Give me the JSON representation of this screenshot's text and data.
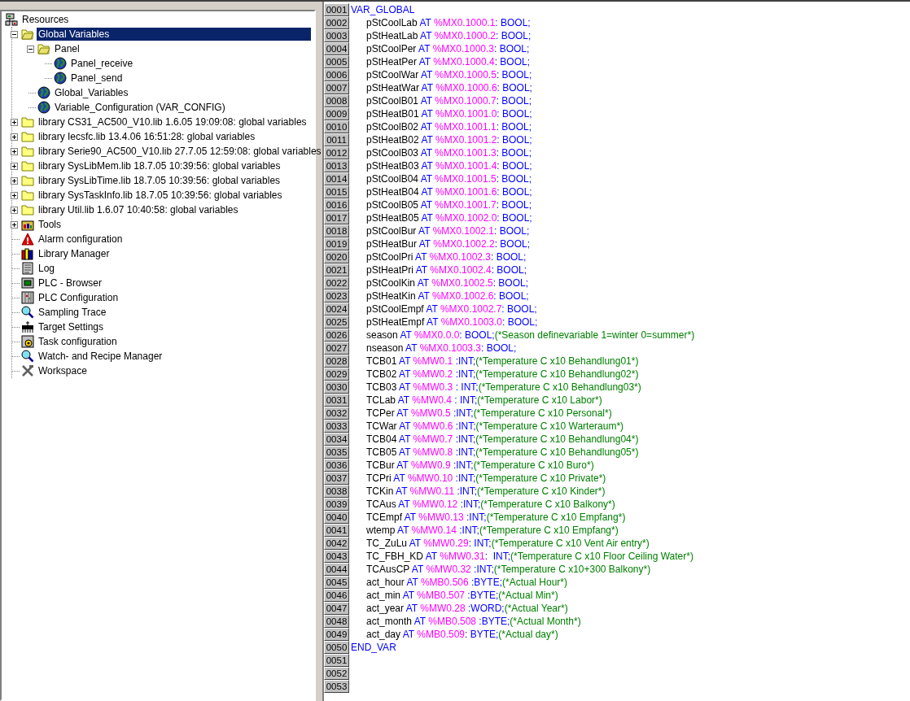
{
  "tree": [
    {
      "label": "Resources",
      "kind": "resources",
      "selected": false,
      "children": [
        {
          "label": "Global Variables",
          "kind": "folder-open",
          "expanded": true,
          "selected": true,
          "children": [
            {
              "label": "Panel",
              "kind": "folder-open",
              "expanded": true,
              "selected": false,
              "children": [
                {
                  "label": "Panel_receive",
                  "kind": "globe",
                  "selected": false
                },
                {
                  "label": "Panel_send",
                  "kind": "globe",
                  "selected": false
                }
              ]
            },
            {
              "label": "Global_Variables",
              "kind": "globe",
              "selected": false
            },
            {
              "label": "Variable_Configuration (VAR_CONFIG)",
              "kind": "globe",
              "selected": false
            }
          ]
        },
        {
          "label": "library CS31_AC500_V10.lib 1.6.05 19:09:08: global variables",
          "kind": "folder",
          "expanded": false,
          "selected": false
        },
        {
          "label": "library Iecsfc.lib 13.4.06 16:51:28: global variables",
          "kind": "folder",
          "expanded": false,
          "selected": false
        },
        {
          "label": "library Serie90_AC500_V10.lib 27.7.05 12:59:08: global variables",
          "kind": "folder",
          "expanded": false,
          "selected": false
        },
        {
          "label": "library SysLibMem.lib 18.7.05 10:39:56: global variables",
          "kind": "folder",
          "expanded": false,
          "selected": false
        },
        {
          "label": "library SysLibTime.lib 18.7.05 10:39:56: global variables",
          "kind": "folder",
          "expanded": false,
          "selected": false
        },
        {
          "label": "library SysTaskInfo.lib 18.7.05 10:39:56: global variables",
          "kind": "folder",
          "expanded": false,
          "selected": false
        },
        {
          "label": "library Util.lib 1.6.07 10:40:58: global variables",
          "kind": "folder",
          "expanded": false,
          "selected": false
        },
        {
          "label": "Tools",
          "kind": "tools",
          "expanded": false,
          "selected": false
        },
        {
          "label": "Alarm configuration",
          "kind": "alarm",
          "selected": false
        },
        {
          "label": "Library Manager",
          "kind": "books",
          "selected": false
        },
        {
          "label": "Log",
          "kind": "log",
          "selected": false
        },
        {
          "label": "PLC - Browser",
          "kind": "monitor",
          "selected": false
        },
        {
          "label": "PLC Configuration",
          "kind": "rack",
          "selected": false
        },
        {
          "label": "Sampling Trace",
          "kind": "magnifier",
          "selected": false
        },
        {
          "label": "Target Settings",
          "kind": "chip",
          "selected": false
        },
        {
          "label": "Task configuration",
          "kind": "task",
          "selected": false
        },
        {
          "label": "Watch- and Recipe Manager",
          "kind": "magnifier",
          "selected": false
        },
        {
          "label": "Workspace",
          "kind": "tools-crossed",
          "selected": false
        }
      ]
    }
  ],
  "editor": {
    "lines": [
      {
        "number": "0001",
        "kind": "block",
        "text": "VAR_GLOBAL"
      },
      {
        "number": "0002",
        "kind": "declaration",
        "name": "pStCoolLab",
        "keyword": "AT",
        "address": "%MX0.1000.1",
        "type": ": BOOL;"
      },
      {
        "number": "0003",
        "kind": "declaration",
        "name": "pStHeatLab",
        "keyword": "AT",
        "address": "%MX0.1000.2",
        "type": ": BOOL;"
      },
      {
        "number": "0004",
        "kind": "declaration",
        "name": "pStCoolPer",
        "keyword": "AT",
        "address": "%MX0.1000.3",
        "type": ": BOOL;"
      },
      {
        "number": "0005",
        "kind": "declaration",
        "name": "pStHeatPer",
        "keyword": "AT",
        "address": "%MX0.1000.4",
        "type": ": BOOL;"
      },
      {
        "number": "0006",
        "kind": "declaration",
        "name": "pStCoolWar",
        "keyword": "AT",
        "address": "%MX0.1000.5",
        "type": ": BOOL;"
      },
      {
        "number": "0007",
        "kind": "declaration",
        "name": "pStHeatWar",
        "keyword": "AT",
        "address": "%MX0.1000.6",
        "type": ": BOOL;"
      },
      {
        "number": "0008",
        "kind": "declaration",
        "name": "pStCoolB01",
        "keyword": "AT",
        "address": "%MX0.1000.7",
        "type": ": BOOL;"
      },
      {
        "number": "0009",
        "kind": "declaration",
        "name": "pStHeatB01",
        "keyword": "AT",
        "address": "%MX0.1001.0",
        "type": ": BOOL;"
      },
      {
        "number": "0010",
        "kind": "declaration",
        "name": "pStCoolB02",
        "keyword": "AT",
        "address": "%MX0.1001.1",
        "type": ": BOOL;"
      },
      {
        "number": "0011",
        "kind": "declaration",
        "name": "pStHeatB02",
        "keyword": "AT",
        "address": "%MX0.1001.2",
        "type": ": BOOL;"
      },
      {
        "number": "0012",
        "kind": "declaration",
        "name": "pStCoolB03",
        "keyword": "AT",
        "address": "%MX0.1001.3",
        "type": ": BOOL;"
      },
      {
        "number": "0013",
        "kind": "declaration",
        "name": "pStHeatB03",
        "keyword": "AT",
        "address": "%MX0.1001.4",
        "type": ": BOOL;"
      },
      {
        "number": "0014",
        "kind": "declaration",
        "name": "pStCoolB04",
        "keyword": "AT",
        "address": "%MX0.1001.5",
        "type": ": BOOL;"
      },
      {
        "number": "0015",
        "kind": "declaration",
        "name": "pStHeatB04",
        "keyword": "AT",
        "address": "%MX0.1001.6",
        "type": ": BOOL;"
      },
      {
        "number": "0016",
        "kind": "declaration",
        "name": "pStCoolB05",
        "keyword": "AT",
        "address": "%MX0.1001.7",
        "type": ": BOOL;"
      },
      {
        "number": "0017",
        "kind": "declaration",
        "name": "pStHeatB05",
        "keyword": "AT",
        "address": "%MX0.1002.0",
        "type": ": BOOL;"
      },
      {
        "number": "0018",
        "kind": "declaration",
        "name": "pStCoolBur",
        "keyword": "AT",
        "address": "%MX0.1002.1",
        "type": ": BOOL;"
      },
      {
        "number": "0019",
        "kind": "declaration",
        "name": "pStHeatBur",
        "keyword": "AT",
        "address": "%MX0.1002.2",
        "type": ": BOOL;"
      },
      {
        "number": "0020",
        "kind": "declaration",
        "name": "pStCoolPri",
        "keyword": "AT",
        "address": "%MX0.1002.3",
        "type": ": BOOL;"
      },
      {
        "number": "0021",
        "kind": "declaration",
        "name": "pStHeatPri",
        "keyword": "AT",
        "address": "%MX0.1002.4",
        "type": ": BOOL;"
      },
      {
        "number": "0022",
        "kind": "declaration",
        "name": "pStCoolKin",
        "keyword": "AT",
        "address": "%MX0.1002.5",
        "type": ": BOOL;"
      },
      {
        "number": "0023",
        "kind": "declaration",
        "name": "pStHeatKin",
        "keyword": "AT",
        "address": "%MX0.1002.6",
        "type": ": BOOL;"
      },
      {
        "number": "0024",
        "kind": "declaration",
        "name": "pStCoolEmpf",
        "keyword": "AT",
        "address": "%MX0.1002.7",
        "type": ": BOOL;"
      },
      {
        "number": "0025",
        "kind": "declaration",
        "name": "pStHeatEmpf",
        "keyword": "AT",
        "address": "%MX0.1003.0",
        "type": ": BOOL;"
      },
      {
        "number": "0026",
        "kind": "declaration",
        "name": "season",
        "keyword": "AT",
        "address": "%MX0.0.0",
        "type": ": BOOL;",
        "comment": "(*Season definevariable 1=winter 0=summer*)"
      },
      {
        "number": "0027",
        "kind": "declaration",
        "name": "nseason",
        "keyword": "AT",
        "address": "%MX0.1003.3",
        "type": ": BOOL;"
      },
      {
        "number": "0028",
        "kind": "declaration",
        "name": "TCB01",
        "keyword": "AT",
        "address": "%MW0.1",
        "type": " :INT;",
        "comment": "(*Temperature C x10 Behandlung01*)"
      },
      {
        "number": "0029",
        "kind": "declaration",
        "name": "TCB02",
        "keyword": "AT",
        "address": "%MW0.2",
        "type": " :INT;",
        "comment": "(*Temperature C x10 Behandlung02*)"
      },
      {
        "number": "0030",
        "kind": "declaration",
        "name": "TCB03",
        "keyword": "AT",
        "address": "%MW0.3",
        "type": " : INT;",
        "comment": "(*Temperature C x10 Behandlung03*)"
      },
      {
        "number": "0031",
        "kind": "declaration",
        "name": "TCLab",
        "keyword": "AT",
        "address": "%MW0.4",
        "type": " : INT;",
        "comment": "(*Temperature C x10 Labor*)"
      },
      {
        "number": "0032",
        "kind": "declaration",
        "name": "TCPer",
        "keyword": "AT",
        "address": "%MW0.5",
        "type": " :INT;",
        "comment": "(*Temperature C x10 Personal*)"
      },
      {
        "number": "0033",
        "kind": "declaration",
        "name": "TCWar",
        "keyword": "AT",
        "address": "%MW0.6",
        "type": " :INT;",
        "comment": "(*Temperature C x10 Warteraum*)"
      },
      {
        "number": "0034",
        "kind": "declaration",
        "name": "TCB04",
        "keyword": "AT",
        "address": "%MW0.7",
        "type": " :INT;",
        "comment": "(*Temperature C x10 Behandlung04*)"
      },
      {
        "number": "0035",
        "kind": "declaration",
        "name": "TCB05",
        "keyword": "AT",
        "address": "%MW0.8",
        "type": " :INT;",
        "comment": "(*Temperature C x10 Behandlung05*)"
      },
      {
        "number": "0036",
        "kind": "declaration",
        "name": "TCBur",
        "keyword": "AT",
        "address": "%MW0.9",
        "type": " :INT;",
        "comment": "(*Temperature C x10 Buro*)"
      },
      {
        "number": "0037",
        "kind": "declaration",
        "name": "TCPri",
        "keyword": "AT",
        "address": "%MW0.10",
        "type": " :INT;",
        "comment": "(*Temperature C x10 Private*)"
      },
      {
        "number": "0038",
        "kind": "declaration",
        "name": "TCKin",
        "keyword": "AT",
        "address": "%MW0.11",
        "type": " :INT;",
        "comment": "(*Temperature C x10 Kinder*)"
      },
      {
        "number": "0039",
        "kind": "declaration",
        "name": "TCAus",
        "keyword": "AT",
        "address": "%MW0.12",
        "type": " :INT;",
        "comment": "(*Temperature C x10 Balkony*)"
      },
      {
        "number": "0040",
        "kind": "declaration",
        "name": "TCEmpf",
        "keyword": "AT",
        "address": "%MW0.13",
        "type": " :INT;",
        "comment": "(*Temperature C x10 Empfang*)"
      },
      {
        "number": "0041",
        "kind": "declaration",
        "name": "wtemp",
        "keyword": "AT",
        "address": "%MW0.14",
        "type": " :INT;",
        "comment": "(*Temperature C x10 Empfang*)"
      },
      {
        "number": "0042",
        "kind": "declaration",
        "name": "TC_ZuLu",
        "keyword": "AT",
        "address": "%MW0.29",
        "type": ": INT;",
        "comment": "(*Temperature C x10 Vent Air entry*)"
      },
      {
        "number": "0043",
        "kind": "declaration",
        "name": "TC_FBH_KD",
        "keyword": "AT",
        "address": "%MW0.31",
        "type": ":  INT;",
        "comment": "(*Temperature C x10 Floor Ceiling Water*)"
      },
      {
        "number": "0044",
        "kind": "declaration",
        "name": "TCAusCP",
        "keyword": "AT",
        "address": "%MW0.32",
        "type": " :INT;",
        "comment": "(*Temperature C x10+300 Balkony*)"
      },
      {
        "number": "0045",
        "kind": "declaration",
        "name": "act_hour",
        "keyword": "AT",
        "address": "%MB0.506",
        "type": " :BYTE;",
        "comment": "(*Actual Hour*)"
      },
      {
        "number": "0046",
        "kind": "declaration",
        "name": "act_min",
        "keyword": "AT",
        "address": "%MB0.507",
        "type": " :BYTE;",
        "comment": "(*Actual Min*)"
      },
      {
        "number": "0047",
        "kind": "declaration",
        "name": "act_year",
        "keyword": "AT",
        "address": "%MW0.28",
        "type": " :WORD;",
        "comment": "(*Actual Year*)"
      },
      {
        "number": "0048",
        "kind": "declaration",
        "name": "act_month",
        "keyword": "AT",
        "address": "%MB0.508",
        "type": " :BYTE;",
        "comment": "(*Actual Month*)"
      },
      {
        "number": "0049",
        "kind": "declaration",
        "name": "act_day",
        "keyword": "AT",
        "address": "%MB0.509",
        "type": ": BYTE;",
        "comment": "(*Actual day*)"
      },
      {
        "number": "0050",
        "kind": "block",
        "text": "END_VAR"
      },
      {
        "number": "0051",
        "kind": "empty"
      },
      {
        "number": "0052",
        "kind": "empty"
      },
      {
        "number": "0053",
        "kind": "empty"
      }
    ]
  }
}
